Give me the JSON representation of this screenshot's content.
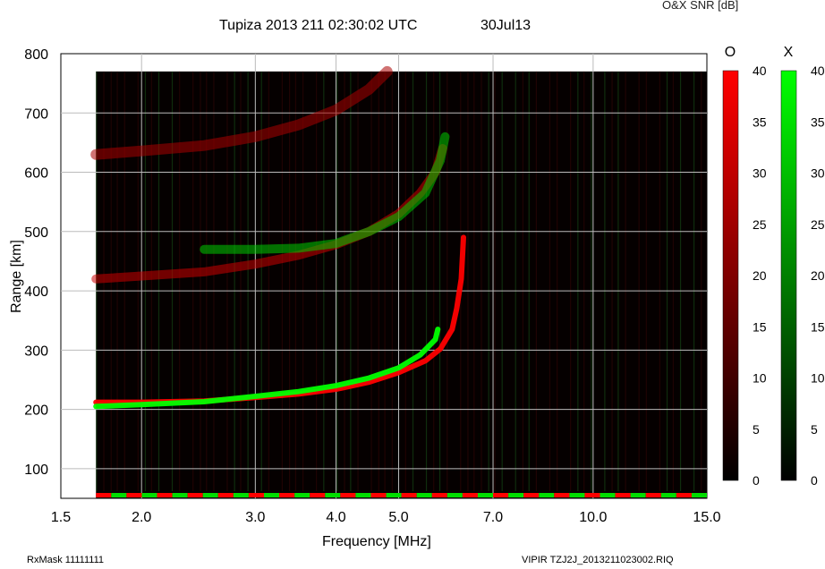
{
  "header": {
    "title": "Tupiza 2013 211 02:30:02 UTC",
    "date": "30Jul13",
    "snr_label": "O&X SNR [dB]"
  },
  "footer": {
    "rxmask": "RxMask 11111111",
    "file": "VIPIR  TZJ2J_2013211023002.RIQ"
  },
  "chart_data": {
    "type": "heatmap",
    "title": "Tupiza 2013 211 02:30:02 UTC",
    "xlabel": "Frequency [MHz]",
    "ylabel": "Range [km]",
    "x_scale": "log",
    "xlim": [
      1.5,
      15.0
    ],
    "ylim": [
      50,
      800
    ],
    "x_ticks": [
      "1.5",
      "2.0",
      "3.0",
      "4.0",
      "5.0",
      "7.0",
      "10.0",
      "15.0"
    ],
    "x_tick_values": [
      1.5,
      2.0,
      3.0,
      4.0,
      5.0,
      7.0,
      10.0,
      15.0
    ],
    "y_ticks": [
      "100",
      "200",
      "300",
      "400",
      "500",
      "600",
      "700",
      "800"
    ],
    "y_tick_values": [
      100,
      200,
      300,
      400,
      500,
      600,
      700,
      800
    ],
    "grid": true,
    "colorbars": [
      {
        "name": "O",
        "color": "#ff0000",
        "min": 0,
        "max": 40,
        "ticks": [
          "0",
          "5",
          "10",
          "15",
          "20",
          "25",
          "30",
          "35",
          "40"
        ]
      },
      {
        "name": "X",
        "color": "#00ff00",
        "min": 0,
        "max": 40,
        "ticks": [
          "0",
          "5",
          "10",
          "15",
          "20",
          "25",
          "30",
          "35",
          "40"
        ]
      }
    ],
    "series": [
      {
        "name": "O",
        "color": "#ff0000",
        "points": [
          [
            1.7,
            212
          ],
          [
            2.0,
            212
          ],
          [
            2.5,
            214
          ],
          [
            3.0,
            220
          ],
          [
            3.5,
            226
          ],
          [
            4.0,
            234
          ],
          [
            4.5,
            246
          ],
          [
            5.0,
            262
          ],
          [
            5.5,
            282
          ],
          [
            5.8,
            302
          ],
          [
            6.05,
            335
          ],
          [
            6.15,
            370
          ],
          [
            6.25,
            420
          ],
          [
            6.3,
            490
          ]
        ]
      },
      {
        "name": "X",
        "color": "#00ff00",
        "points": [
          [
            1.7,
            205
          ],
          [
            2.0,
            208
          ],
          [
            2.5,
            213
          ],
          [
            3.0,
            222
          ],
          [
            3.5,
            230
          ],
          [
            4.0,
            240
          ],
          [
            4.5,
            253
          ],
          [
            5.0,
            270
          ],
          [
            5.4,
            292
          ],
          [
            5.7,
            318
          ],
          [
            5.75,
            335
          ]
        ]
      },
      {
        "name": "O",
        "color": "#cc0000",
        "points": [
          [
            1.7,
            420
          ],
          [
            2.0,
            425
          ],
          [
            2.5,
            432
          ],
          [
            3.0,
            445
          ],
          [
            3.5,
            460
          ],
          [
            4.0,
            478
          ],
          [
            4.5,
            500
          ],
          [
            5.0,
            530
          ],
          [
            5.4,
            565
          ],
          [
            5.7,
            600
          ],
          [
            5.85,
            640
          ]
        ]
      },
      {
        "name": "X",
        "color": "#00cc00",
        "points": [
          [
            2.5,
            470
          ],
          [
            3.0,
            470
          ],
          [
            3.5,
            472
          ],
          [
            4.0,
            480
          ],
          [
            4.5,
            500
          ],
          [
            5.0,
            525
          ],
          [
            5.5,
            565
          ],
          [
            5.8,
            620
          ],
          [
            5.9,
            660
          ]
        ]
      },
      {
        "name": "O",
        "color": "#aa0000",
        "points": [
          [
            1.7,
            630
          ],
          [
            2.0,
            636
          ],
          [
            2.5,
            645
          ],
          [
            3.0,
            660
          ],
          [
            3.5,
            680
          ],
          [
            4.0,
            705
          ],
          [
            4.5,
            740
          ],
          [
            4.8,
            770
          ]
        ]
      }
    ]
  }
}
